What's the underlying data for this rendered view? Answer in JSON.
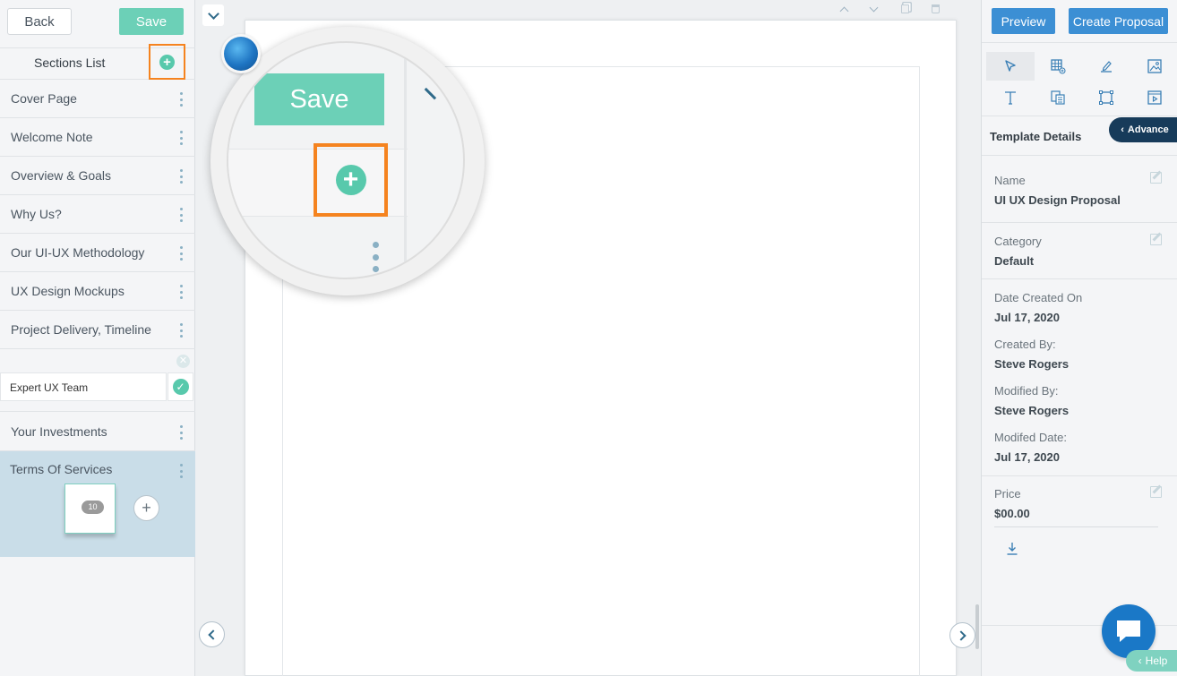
{
  "left_panel": {
    "back_label": "Back",
    "save_label": "Save",
    "sections_title": "Sections List",
    "sections": [
      {
        "label": "Cover Page"
      },
      {
        "label": "Welcome Note"
      },
      {
        "label": "Overview & Goals"
      },
      {
        "label": "Why Us?"
      },
      {
        "label": "Our UI-UX Methodology"
      },
      {
        "label": "UX Design Mockups"
      },
      {
        "label": "Project Delivery, Timeline"
      }
    ],
    "editing_section_value": "Expert UX Team",
    "section_investments": "Your Investments",
    "section_active": "Terms Of Services",
    "page_thumbnail_badge": "10"
  },
  "magnifier": {
    "save_label": "Save"
  },
  "right_panel": {
    "preview_label": "Preview",
    "create_label": "Create Proposal",
    "advance_label": "Advance",
    "template_details_title": "Template Details",
    "fields": {
      "name_label": "Name",
      "name_value": "UI UX Design Proposal",
      "category_label": "Category",
      "category_value": "Default",
      "date_created_label": "Date Created On",
      "date_created_value": "Jul 17, 2020",
      "created_by_label": "Created By:",
      "created_by_value": "Steve Rogers",
      "modified_by_label": "Modified By:",
      "modified_by_value": "Steve Rogers",
      "modified_date_label": "Modifed Date:",
      "modified_date_value": "Jul 17, 2020",
      "price_label": "Price",
      "price_value": "$00.00"
    },
    "help_label": "Help"
  },
  "colors": {
    "accent_green": "#58c9ac",
    "highlight_orange": "#f5831f",
    "primary_blue": "#3c8fd4",
    "dark_navy": "#173b5a"
  }
}
